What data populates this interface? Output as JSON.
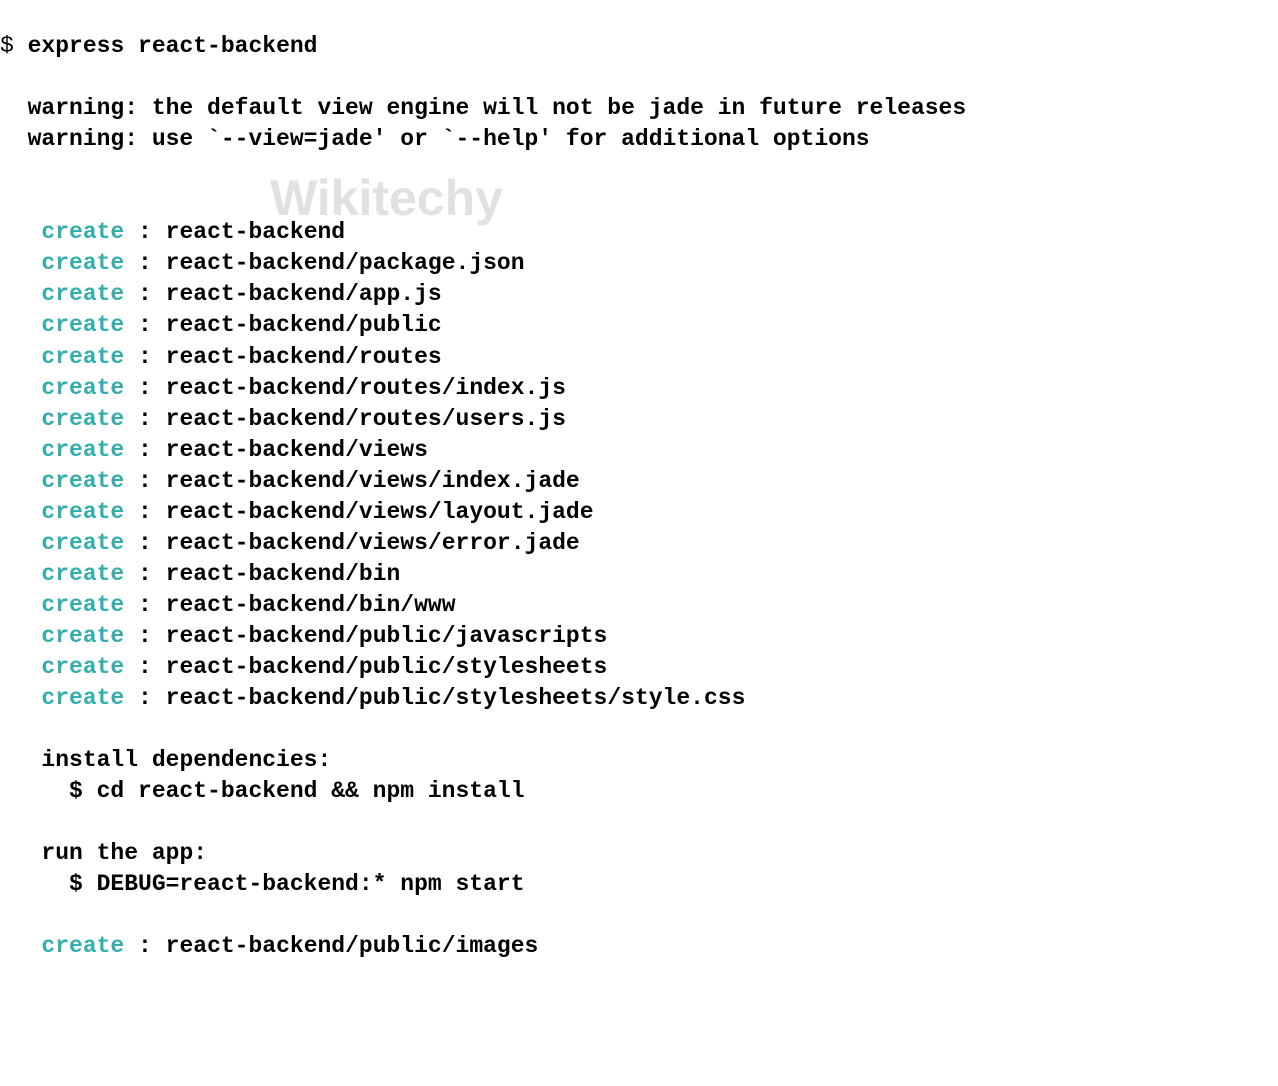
{
  "prompt_symbol": "$",
  "command": "express react-backend",
  "warnings": [
    "warning: the default view engine will not be jade in future releases",
    "warning: use `--view=jade' or `--help' for additional options"
  ],
  "create_label": "create",
  "create_items": [
    "react-backend",
    "react-backend/package.json",
    "react-backend/app.js",
    "react-backend/public",
    "react-backend/routes",
    "react-backend/routes/index.js",
    "react-backend/routes/users.js",
    "react-backend/views",
    "react-backend/views/index.jade",
    "react-backend/views/layout.jade",
    "react-backend/views/error.jade",
    "react-backend/bin",
    "react-backend/bin/www",
    "react-backend/public/javascripts",
    "react-backend/public/stylesheets",
    "react-backend/public/stylesheets/style.css"
  ],
  "install_heading": "install dependencies:",
  "install_cmd": "$ cd react-backend && npm install",
  "run_heading": "run the app:",
  "run_cmd": "$ DEBUG=react-backend:* npm start",
  "trailing_create": "react-backend/public/images",
  "watermark": "Wikitechy"
}
